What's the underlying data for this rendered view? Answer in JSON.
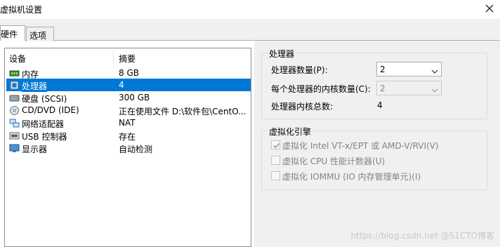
{
  "window": {
    "title": "虚拟机设置"
  },
  "tabs": [
    {
      "label": "硬件"
    },
    {
      "label": "选项"
    }
  ],
  "device_list": {
    "headers": {
      "device": "设备",
      "summary": "摘要"
    },
    "items": [
      {
        "name": "内存",
        "value": "8 GB",
        "icon": "memory-icon"
      },
      {
        "name": "处理器",
        "value": "4",
        "icon": "processor-icon",
        "selected": true
      },
      {
        "name": "硬盘 (SCSI)",
        "value": "300 GB",
        "icon": "hard-disk-icon"
      },
      {
        "name": "CD/DVD (IDE)",
        "value": "正在使用文件 D:\\软件包\\CentO...",
        "icon": "cd-dvd-icon"
      },
      {
        "name": "网络适配器",
        "value": "NAT",
        "icon": "network-adapter-icon"
      },
      {
        "name": "USB 控制器",
        "value": "存在",
        "icon": "usb-controller-icon"
      },
      {
        "name": "显示器",
        "value": "自动检测",
        "icon": "display-icon"
      }
    ]
  },
  "processor": {
    "group_title": "处理器",
    "count_label": "处理器数量(P):",
    "count_value": "2",
    "cores_label": "每个处理器的内核数量(C):",
    "cores_value": "2",
    "total_label": "处理器内核总数:",
    "total_value": "4"
  },
  "virtualization": {
    "group_title": "虚拟化引擎",
    "options": [
      {
        "label": "虚拟化 Intel VT-x/EPT 或 AMD-V/RVI(V)",
        "checked": true,
        "disabled": true
      },
      {
        "label": "虚拟化 CPU 性能计数器(U)",
        "checked": false,
        "disabled": true
      },
      {
        "label": "虚拟化 IOMMU (IO 内存管理单元)(I)",
        "checked": false,
        "disabled": true
      }
    ]
  },
  "watermark": "https://blog.csdn.net @51CTO博客",
  "colors": {
    "selection": "#0078d7",
    "disabled_text": "#838383"
  }
}
